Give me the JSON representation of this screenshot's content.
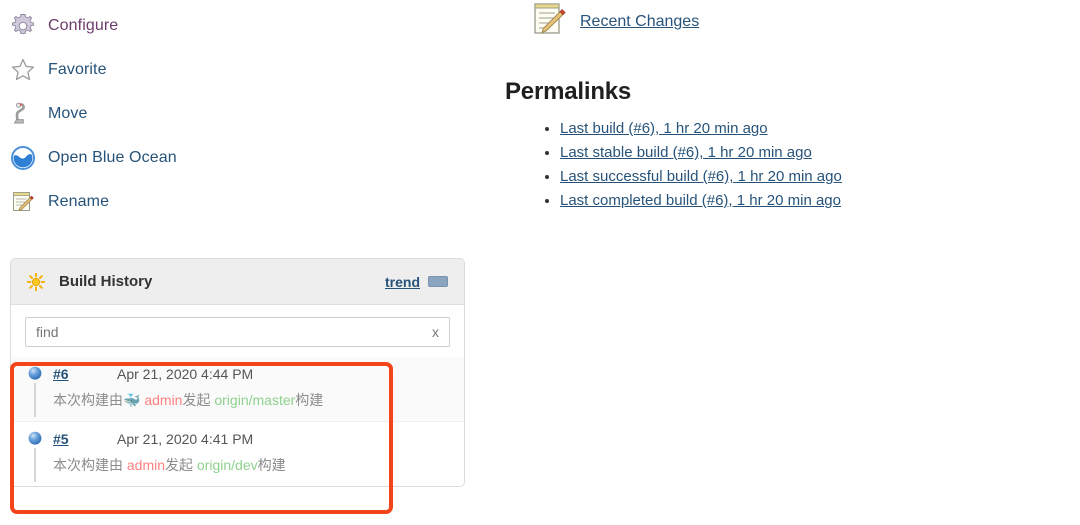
{
  "task_menu": {
    "items": [
      {
        "label": "Configure",
        "icon": "gear-icon",
        "visited": true
      },
      {
        "label": "Favorite",
        "icon": "star-icon",
        "visited": false
      },
      {
        "label": "Move",
        "icon": "move-icon",
        "visited": false
      },
      {
        "label": "Open Blue Ocean",
        "icon": "blue-ocean-icon",
        "visited": false
      },
      {
        "label": "Rename",
        "icon": "rename-pencil-icon",
        "visited": false
      }
    ]
  },
  "build_history": {
    "title": "Build History",
    "header_icon": "sun-icon",
    "trend_label": "trend",
    "collapse_icon": "collapse-icon",
    "find": {
      "value": "",
      "placeholder": "find",
      "clear_label": "x"
    },
    "entries": [
      {
        "number": "#6",
        "date": "Apr 21, 2020 4:44 PM",
        "status_icon": "blue-ball-icon",
        "desc_prefix": "本次构建由",
        "desc_whale": "🐳",
        "desc_user": "admin",
        "desc_mid": "发起",
        "desc_branch": "origin/master",
        "desc_suffix": "构建"
      },
      {
        "number": "#5",
        "date": "Apr 21, 2020 4:41 PM",
        "status_icon": "blue-ball-icon",
        "desc_prefix": "本次构建由",
        "desc_whale": "",
        "desc_user": "admin",
        "desc_mid": "发起",
        "desc_branch": "origin/dev",
        "desc_suffix": "构建"
      }
    ]
  },
  "recent_changes": {
    "label": "Recent Changes",
    "icon": "notepad-pencil-icon"
  },
  "permalinks": {
    "title": "Permalinks",
    "items": [
      {
        "label": "Last build (#6), 1 hr 20 min ago"
      },
      {
        "label": "Last stable build (#6), 1 hr 20 min ago"
      },
      {
        "label": "Last successful build (#6), 1 hr 20 min ago"
      },
      {
        "label": "Last completed build (#6), 1 hr 20 min ago"
      }
    ]
  },
  "colors": {
    "link": "#27537a",
    "visited_link": "#6b3d6b",
    "annotation_red": "#f4451a",
    "user_red": "#ff8080",
    "branch_green": "#8ed18e",
    "panel_header": "#eeeeee"
  }
}
